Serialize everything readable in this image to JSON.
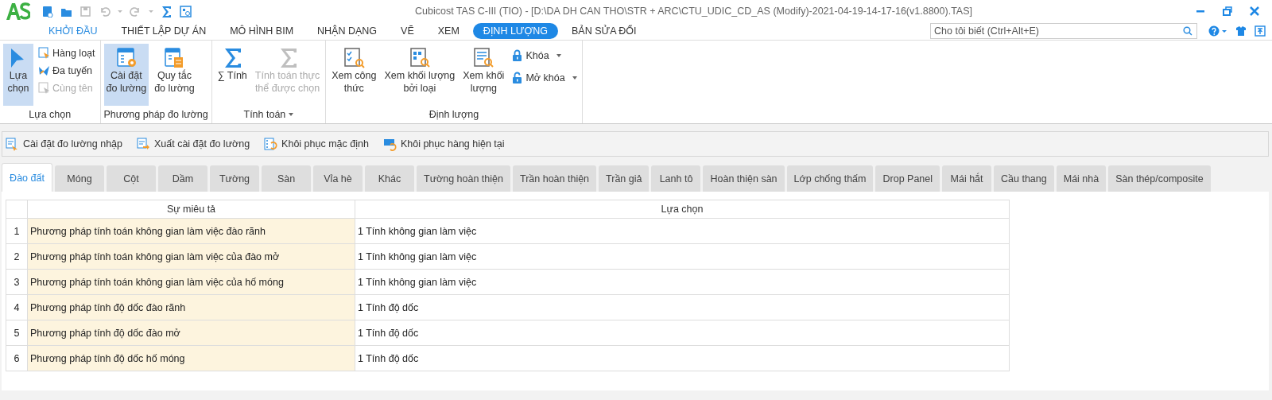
{
  "window": {
    "title": "Cubicost TAS C-III (TIO) - [D:\\DA DH CAN THO\\STR + ARC\\CTU_UDIC_CD_AS (Modify)-2021-04-19-14-17-16(v1.8800).TAS]"
  },
  "search": {
    "placeholder": "Cho tôi biết (Ctrl+Alt+E)"
  },
  "ribbon_tabs": [
    {
      "label": "KHỞI ĐẦU",
      "selected": false,
      "highlighted": true
    },
    {
      "label": "THIẾT LẬP DỰ ÁN",
      "selected": false,
      "highlighted": false
    },
    {
      "label": "MÔ HÌNH BIM",
      "selected": false,
      "highlighted": false
    },
    {
      "label": "NHẬN DẠNG",
      "selected": false,
      "highlighted": false
    },
    {
      "label": "VẼ",
      "selected": false,
      "highlighted": false
    },
    {
      "label": "XEM",
      "selected": false,
      "highlighted": false
    },
    {
      "label": "ĐỊNH LƯỢNG",
      "selected": true,
      "highlighted": false
    },
    {
      "label": "BẢN SỬA ĐỔI",
      "selected": false,
      "highlighted": false
    }
  ],
  "ribbon_groups": [
    {
      "label": "Lựa chọn",
      "dropdown": false,
      "items": [
        {
          "kind": "large",
          "label": "Lựa\nchọn",
          "selected": true,
          "disabled": false,
          "dropdown": false
        },
        {
          "kind": "small",
          "label": "Hàng loạt",
          "selected": false,
          "disabled": false,
          "dropdown": false
        },
        {
          "kind": "small",
          "label": "Đa tuyến",
          "selected": false,
          "disabled": false,
          "dropdown": false
        },
        {
          "kind": "small",
          "label": "Cùng tên",
          "selected": false,
          "disabled": true,
          "dropdown": false
        }
      ]
    },
    {
      "label": "Phương pháp đo lường",
      "dropdown": false,
      "items": [
        {
          "kind": "large",
          "label": "Cài đặt\nđo lường",
          "selected": true,
          "disabled": false,
          "dropdown": false
        },
        {
          "kind": "large",
          "label": "Quy tắc\nđo lường",
          "selected": false,
          "disabled": false,
          "dropdown": false
        }
      ]
    },
    {
      "label": "Tính toán",
      "dropdown": true,
      "items": [
        {
          "kind": "large",
          "label": "∑ Tính",
          "selected": false,
          "disabled": false,
          "dropdown": false
        },
        {
          "kind": "large",
          "label": "Tính toán thực\nthể được chọn",
          "selected": false,
          "disabled": true,
          "dropdown": false
        }
      ]
    },
    {
      "label": "Định lượng",
      "dropdown": false,
      "items": [
        {
          "kind": "large",
          "label": "Xem công\nthức",
          "selected": false,
          "disabled": false,
          "dropdown": false
        },
        {
          "kind": "large",
          "label": "Xem khối lượng\nbởi loại",
          "selected": false,
          "disabled": false,
          "dropdown": false
        },
        {
          "kind": "large",
          "label": "Xem khối\nlượng",
          "selected": false,
          "disabled": false,
          "dropdown": false
        },
        {
          "kind": "small",
          "label": "Khóa",
          "selected": false,
          "disabled": false,
          "dropdown": true
        },
        {
          "kind": "small",
          "label": "Mở khóa",
          "selected": false,
          "disabled": false,
          "dropdown": true
        }
      ]
    }
  ],
  "toolbar": [
    "Cài đặt đo lường nhập",
    "Xuất cài đặt đo lường",
    "Khôi phục mặc định",
    "Khôi phục hàng hiện tại"
  ],
  "tabs": [
    {
      "label": "Đào đất",
      "selected": true
    },
    {
      "label": "Móng",
      "selected": false
    },
    {
      "label": "Cột",
      "selected": false
    },
    {
      "label": "Dầm",
      "selected": false
    },
    {
      "label": "Tường",
      "selected": false
    },
    {
      "label": "Sàn",
      "selected": false
    },
    {
      "label": "Vỉa hè",
      "selected": false
    },
    {
      "label": "Khác",
      "selected": false
    },
    {
      "label": "Tường hoàn thiện",
      "selected": false
    },
    {
      "label": "Trần hoàn thiện",
      "selected": false
    },
    {
      "label": "Trần giả",
      "selected": false
    },
    {
      "label": "Lanh tô",
      "selected": false
    },
    {
      "label": "Hoàn thiện sàn",
      "selected": false
    },
    {
      "label": "Lớp chống thấm",
      "selected": false
    },
    {
      "label": "Drop Panel",
      "selected": false
    },
    {
      "label": "Mái hắt",
      "selected": false
    },
    {
      "label": "Cầu thang",
      "selected": false
    },
    {
      "label": "Mái nhà",
      "selected": false
    },
    {
      "label": "Sàn thép/composite",
      "selected": false
    }
  ],
  "table": {
    "columns": [
      "Sự miêu tả",
      "Lựa chọn"
    ],
    "rows": [
      {
        "index": "1",
        "description": "Phương pháp tính toán không gian làm việc đào rãnh",
        "choice": "1 Tính không gian làm việc"
      },
      {
        "index": "2",
        "description": "Phương pháp tính toán không gian làm việc của đào mở",
        "choice": "1 Tính không gian làm việc"
      },
      {
        "index": "3",
        "description": "Phương pháp tính toán không gian làm việc của hố móng",
        "choice": "1 Tính không gian làm việc"
      },
      {
        "index": "4",
        "description": "Phương pháp tính độ dốc đào rãnh",
        "choice": "1 Tính độ dốc"
      },
      {
        "index": "5",
        "description": "Phương pháp tính độ dốc đào mở",
        "choice": "1 Tính độ dốc"
      },
      {
        "index": "6",
        "description": "Phương pháp tính độ dốc hố móng",
        "choice": "1 Tính độ dốc"
      }
    ]
  }
}
